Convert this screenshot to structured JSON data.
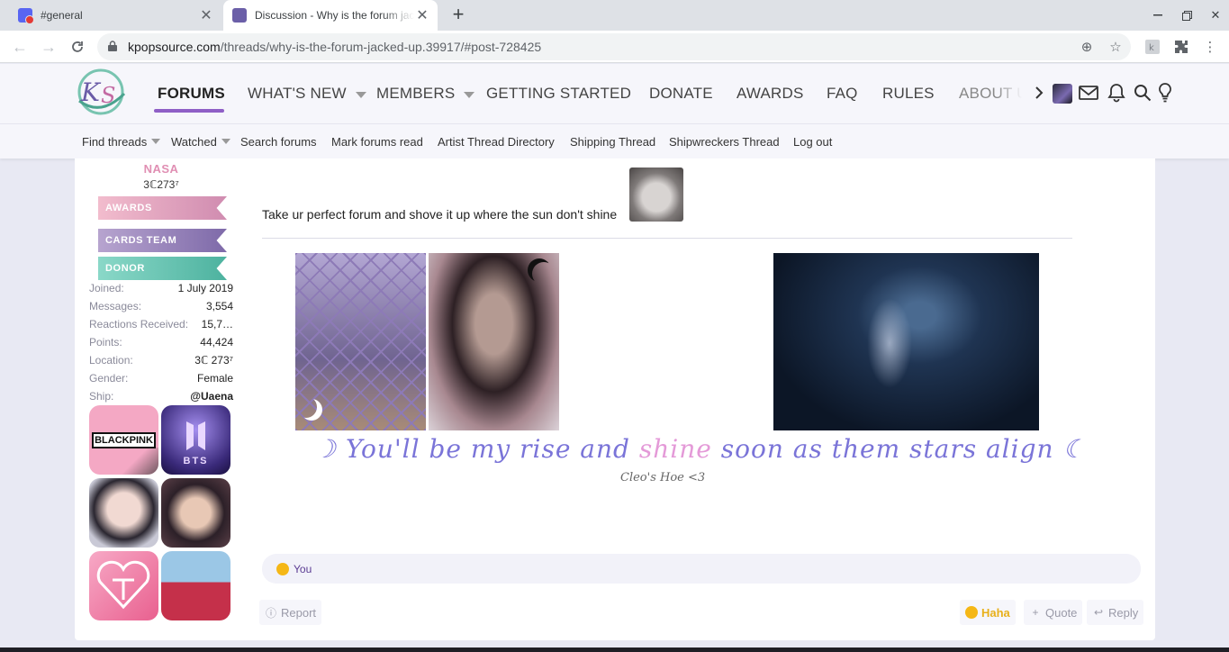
{
  "browser": {
    "tabs": [
      {
        "title": "#general"
      },
      {
        "title": "Discussion - Why is the forum jacked up"
      }
    ],
    "url_domain": "kpopsource.com",
    "url_path": "/threads/why-is-the-forum-jacked-up.39917/#post-728425"
  },
  "site": {
    "logo_text": "KS",
    "nav": {
      "forums": "FORUMS",
      "whats_new": "WHAT'S NEW",
      "members": "MEMBERS",
      "getting_started": "GETTING STARTED",
      "donate": "DONATE",
      "awards": "AWARDS",
      "faq": "FAQ",
      "rules": "RULES",
      "about": "ABOUT U"
    },
    "subnav": {
      "find_threads": "Find threads",
      "watched": "Watched",
      "search_forums": "Search forums",
      "mark_read": "Mark forums read",
      "artist_directory": "Artist Thread Directory",
      "shipping_thread": "Shipping Thread",
      "shipwreckers_thread": "Shipwreckers Thread",
      "log_out": "Log out"
    }
  },
  "user": {
    "name": "NASA",
    "title": "3ℂ273⁷",
    "banners": {
      "awards": "Awards",
      "cards_team": "Cards Team",
      "donor": "Donor"
    },
    "info": [
      {
        "label": "Joined:",
        "value": "1 July 2019"
      },
      {
        "label": "Messages:",
        "value": "3,554"
      },
      {
        "label": "Reactions Received:",
        "value": "15,7…"
      },
      {
        "label": "Points:",
        "value": "44,424"
      },
      {
        "label": "Location:",
        "value": "3ℂ 273⁷"
      },
      {
        "label": "Gender:",
        "value": "Female"
      },
      {
        "label": "Ship:",
        "value": "@Uaena"
      }
    ],
    "badges": {
      "blackpink": "BLACKPINK",
      "bts": "BTS"
    }
  },
  "post": {
    "text": "Take ur perfect forum and shove it up where the sun don't shine",
    "signature": {
      "quote_start": "☽ You'll be my rise and ",
      "quote_pink": "shine",
      "quote_end": " soon as them stars align ☾",
      "credit": "Cleo's Hoe <3"
    },
    "reaction_summary": "You",
    "actions": {
      "report": "Report",
      "haha": "Haha",
      "quote": "Quote",
      "reply": "Reply"
    }
  },
  "colors": {
    "accent": "#8f5fc6",
    "link": "#5b3c93",
    "haha": "#e8b01a"
  }
}
